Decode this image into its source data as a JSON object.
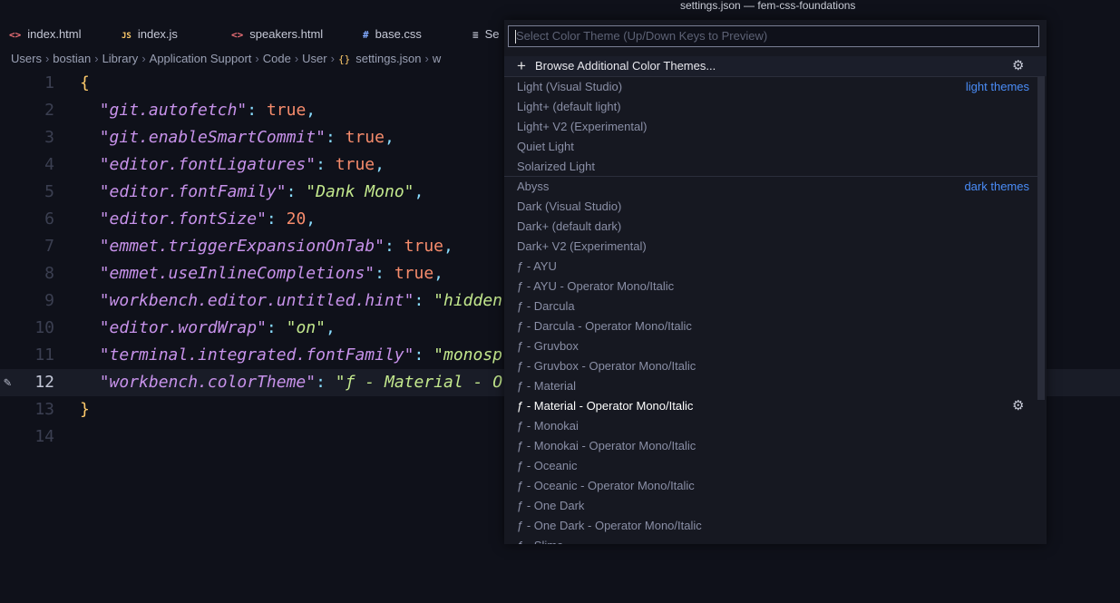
{
  "window": {
    "title": "settings.json — fem-css-foundations"
  },
  "tabs": [
    {
      "icon": "<>",
      "label": "index.html"
    },
    {
      "icon": "JS",
      "label": "index.js"
    },
    {
      "icon": "<>",
      "label": "speakers.html"
    },
    {
      "icon": "#",
      "label": "base.css"
    },
    {
      "icon": "≡",
      "label": "Se"
    }
  ],
  "breadcrumb": {
    "items": [
      "Users",
      "bostian",
      "Library",
      "Application Support",
      "Code",
      "User"
    ],
    "file_icon": "{}",
    "file": "settings.json",
    "tail": "w"
  },
  "editor": {
    "current_line": 12,
    "line_numbers": [
      "1",
      "2",
      "3",
      "4",
      "5",
      "6",
      "7",
      "8",
      "9",
      "10",
      "11",
      "12",
      "13",
      "14"
    ],
    "lines": [
      {
        "key": "\"git.autofetch\"",
        "value": "true"
      },
      {
        "key": "\"git.enableSmartCommit\"",
        "value": "true"
      },
      {
        "key": "\"editor.fontLigatures\"",
        "value": "true"
      },
      {
        "key": "\"editor.fontFamily\"",
        "value": "\"Dank Mono\""
      },
      {
        "key": "\"editor.fontSize\"",
        "value": "20"
      },
      {
        "key": "\"emmet.triggerExpansionOnTab\"",
        "value": "true"
      },
      {
        "key": "\"emmet.useInlineCompletions\"",
        "value": "true"
      },
      {
        "key": "\"workbench.editor.untitled.hint\"",
        "value": "\"hidden"
      },
      {
        "key": "\"editor.wordWrap\"",
        "value": "\"on\""
      },
      {
        "key": "\"terminal.integrated.fontFamily\"",
        "value": "\"monosp"
      },
      {
        "key": "\"workbench.colorTheme\"",
        "value": "\"ƒ - Material - O"
      }
    ],
    "open_brace": "{",
    "close_brace": "}",
    "colon": ":",
    "comma": ","
  },
  "picker": {
    "placeholder": "Select Color Theme (Up/Down Keys to Preview)",
    "browse_label": "Browse Additional Color Themes...",
    "light_group_label": "light themes",
    "dark_group_label": "dark themes",
    "light_themes": [
      "Light (Visual Studio)",
      "Light+ (default light)",
      "Light+ V2 (Experimental)",
      "Quiet Light",
      "Solarized Light"
    ],
    "dark_themes": [
      "Abyss",
      "Dark (Visual Studio)",
      "Dark+ (default dark)",
      "Dark+ V2 (Experimental)",
      "ƒ - AYU",
      "ƒ - AYU - Operator Mono/Italic",
      "ƒ - Darcula",
      "ƒ - Darcula - Operator Mono/Italic",
      "ƒ - Gruvbox",
      "ƒ - Gruvbox - Operator Mono/Italic",
      "ƒ - Material",
      "ƒ - Material - Operator Mono/Italic",
      "ƒ - Monokai",
      "ƒ - Monokai - Operator Mono/Italic",
      "ƒ - Oceanic",
      "ƒ - Oceanic - Operator Mono/Italic",
      "ƒ - One Dark",
      "ƒ - One Dark - Operator Mono/Italic",
      "ƒ - Slime"
    ],
    "active_theme": "ƒ - Material - Operator Mono/Italic"
  }
}
